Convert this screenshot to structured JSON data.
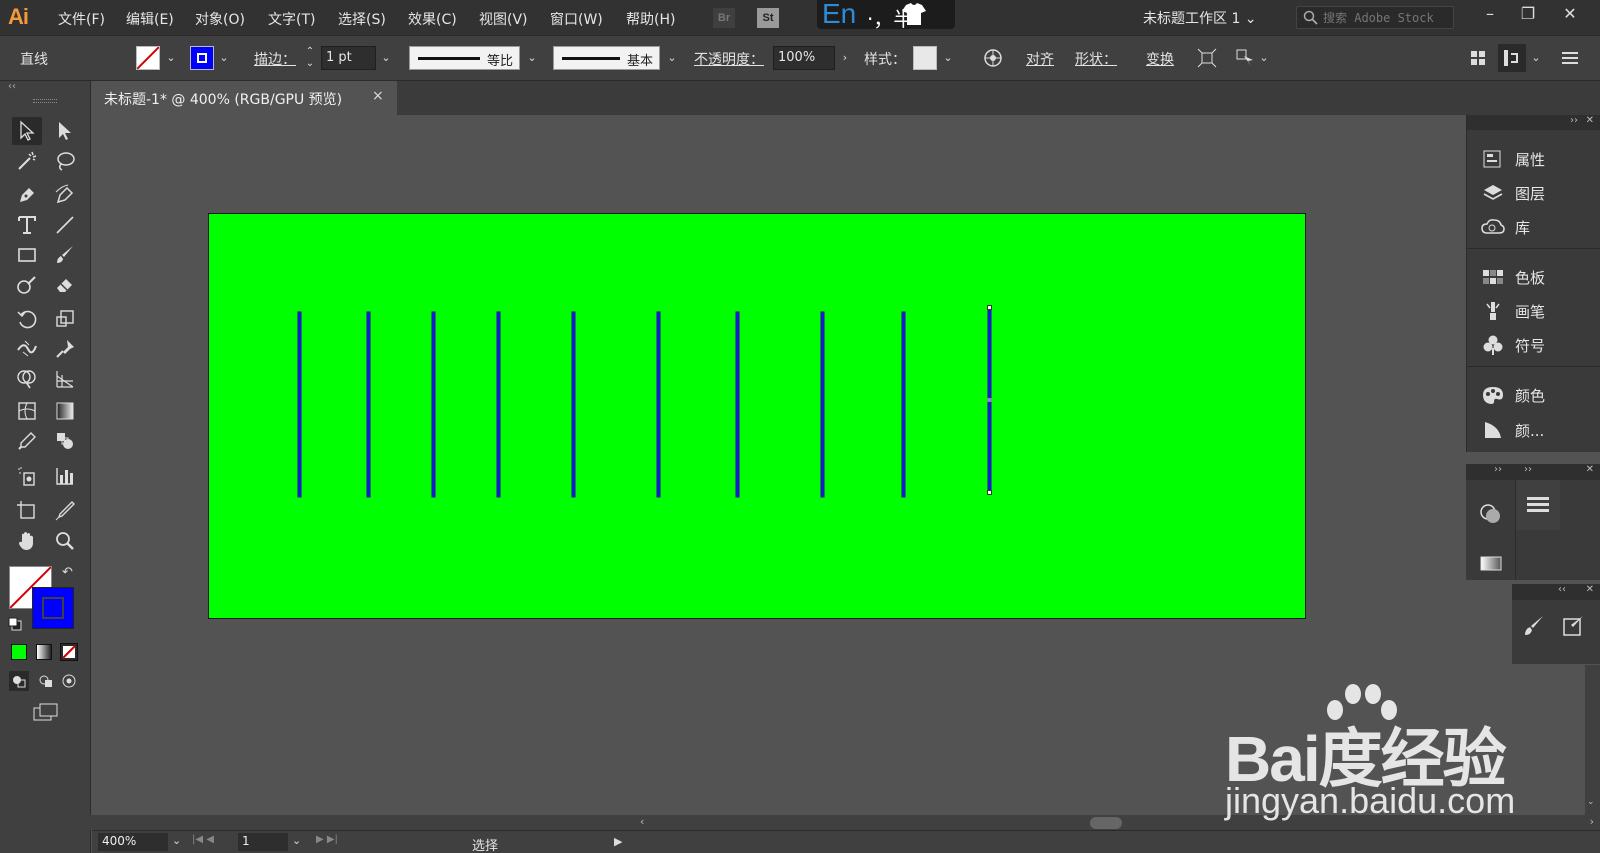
{
  "app": {
    "logo": "Ai"
  },
  "menu": [
    "文件(F)",
    "编辑(E)",
    "对象(O)",
    "文字(T)",
    "选择(S)",
    "效果(C)",
    "视图(V)",
    "窗口(W)",
    "帮助(H)"
  ],
  "bridges": {
    "br": "Br",
    "st": "St"
  },
  "ime": {
    "lang": "En",
    "rest": "·，半"
  },
  "workspace": "未标题工作区 1",
  "stock_search": {
    "placeholder": "搜索 Adobe Stock"
  },
  "control": {
    "selection_label": "直线",
    "stroke_label": "描边：",
    "stroke_weight": "1 pt",
    "profile_label": "等比",
    "brush_label": "基本",
    "opacity_label": "不透明度：",
    "opacity_value": "100%",
    "style_label": "样式：",
    "align_label": "对齐",
    "shape_label": "形状：",
    "transform_label": "变换"
  },
  "document_tab": {
    "title": "未标题-1* @ 400% (RGB/GPU 预览)",
    "close": "×"
  },
  "canvas": {
    "artboard_color": "#00ff00",
    "stroke_color": "#1a1ad6",
    "line_count": 10,
    "selected_line_index": 9
  },
  "panels": {
    "group1": [
      "属性",
      "图层",
      "库"
    ],
    "group2": [
      "色板",
      "画笔",
      "符号"
    ],
    "group3": [
      "颜色",
      "颜..."
    ]
  },
  "status": {
    "zoom": "400%",
    "page": "1",
    "mode": "选择"
  },
  "watermark": {
    "logo": "Bai度经验",
    "url": "jingyan.baidu.com"
  },
  "colors": {
    "fill_none": "#ffffff",
    "stroke": "#0000ff",
    "accent": "#f29a3a"
  }
}
